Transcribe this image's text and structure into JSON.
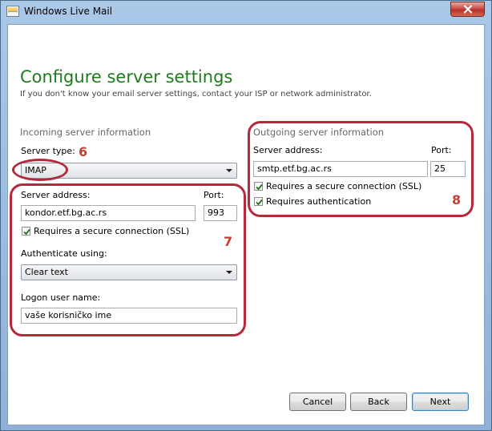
{
  "window": {
    "title": "Windows Live Mail",
    "close_icon": "close-x-icon"
  },
  "page": {
    "heading": "Configure server settings",
    "subheading": "If you don't know your email server settings, contact your ISP or network administrator."
  },
  "incoming": {
    "section_label": "Incoming server information",
    "server_type_label": "Server type:",
    "server_type_value": "IMAP",
    "server_address_label": "Server address:",
    "server_address_value": "kondor.etf.bg.ac.rs",
    "port_label": "Port:",
    "port_value": "993",
    "ssl_label": "Requires a secure connection (SSL)",
    "ssl_checked": true,
    "authenticate_label": "Authenticate using:",
    "authenticate_value": "Clear text",
    "logon_label": "Logon user name:",
    "logon_value": "vaše korisničko ime"
  },
  "outgoing": {
    "section_label": "Outgoing server information",
    "server_address_label": "Server address:",
    "server_address_value": "smtp.etf.bg.ac.rs",
    "port_label": "Port:",
    "port_value": "25",
    "ssl_label": "Requires a secure connection (SSL)",
    "ssl_checked": true,
    "auth_label": "Requires authentication",
    "auth_checked": true
  },
  "annotations": {
    "six": "6",
    "seven": "7",
    "eight": "8",
    "color": "#b52a3a"
  },
  "buttons": {
    "cancel": "Cancel",
    "back": "Back",
    "next": "Next"
  }
}
